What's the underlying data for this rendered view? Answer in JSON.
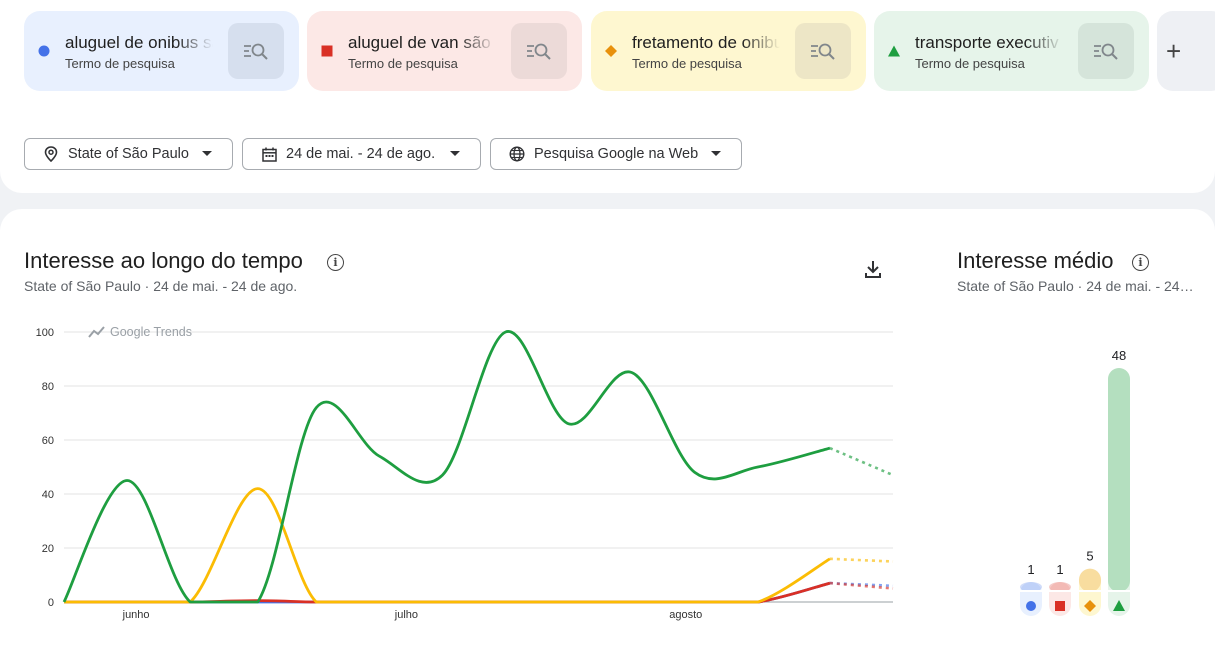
{
  "terms": [
    {
      "label": "aluguel de onibus sã",
      "sub": "Termo de pesquisa",
      "color": "#4472e8",
      "bg": "#e8f0fe",
      "btn_bg": "#d6dfee",
      "marker": "circle"
    },
    {
      "label": "aluguel de van são p",
      "sub": "Termo de pesquisa",
      "color": "#d93025",
      "bg": "#fce8e6",
      "btn_bg": "#ecdad8",
      "marker": "square"
    },
    {
      "label": "fretamento de onibu",
      "sub": "Termo de pesquisa",
      "color": "#e8910c",
      "bg": "#fef7d0",
      "btn_bg": "#ede6c6",
      "marker": "diamond"
    },
    {
      "label": "transporte executiv",
      "sub": "Termo de pesquisa",
      "color": "#1e9e40",
      "bg": "#e6f4ea",
      "btn_bg": "#d5e4da",
      "marker": "triangle"
    }
  ],
  "add_label": "+",
  "filters": {
    "location": "State of São Paulo",
    "date_range": "24 de mai. - 24 de ago.",
    "property": "Pesquisa Google na Web"
  },
  "icons": {
    "location": "location-pin-icon",
    "calendar": "calendar-icon",
    "globe": "globe-icon",
    "explore": "explore-search-icon",
    "download": "download-icon",
    "info": "info-icon",
    "trends": "google-trends-logo-icon"
  },
  "interest_over_time": {
    "title": "Interesse ao longo do tempo",
    "subtitle": "State of São Paulo  ·  24 de mai. - 24 de ago.",
    "watermark": "Google Trends",
    "info": "i"
  },
  "average_interest": {
    "title": "Interesse médio",
    "subtitle": "State of São Paulo  ·  24 de mai. - 24…",
    "info": "i"
  },
  "chart_data": [
    {
      "type": "line",
      "x_labels": [
        "junho",
        "julho",
        "agosto"
      ],
      "ylim": [
        0,
        100
      ],
      "yticks": [
        0,
        20,
        40,
        60,
        80,
        100
      ],
      "grid": true,
      "x_days": [
        0,
        7,
        14,
        21,
        28,
        35,
        42,
        49,
        56,
        63,
        70,
        77,
        84,
        91
      ],
      "partial_from_index": 13,
      "series": [
        {
          "color": "#4472e8",
          "values": [
            0,
            0,
            0,
            0,
            0,
            0,
            0,
            0,
            0,
            0,
            0,
            0,
            7,
            6,
            0
          ]
        },
        {
          "color": "#d93025",
          "values": [
            0,
            0,
            0,
            0.5,
            0,
            0,
            0,
            0,
            0,
            0,
            0,
            0,
            7,
            5,
            0
          ]
        },
        {
          "color": "#fbbc04",
          "values": [
            0,
            0,
            0,
            42,
            0,
            0,
            0,
            0,
            0,
            0,
            0,
            0,
            16,
            15,
            0
          ]
        },
        {
          "color": "#1e9e40",
          "values": [
            0,
            45,
            0,
            0,
            72,
            54,
            47,
            100,
            66,
            85,
            48,
            50,
            57,
            47
          ]
        }
      ]
    },
    {
      "type": "bar",
      "categories": [
        "aluguel de onibus sã",
        "aluguel de van são p",
        "fretamento de onibu",
        "transporte executiv"
      ],
      "values": [
        1,
        1,
        5,
        48
      ],
      "ylim": [
        0,
        48
      ]
    }
  ]
}
